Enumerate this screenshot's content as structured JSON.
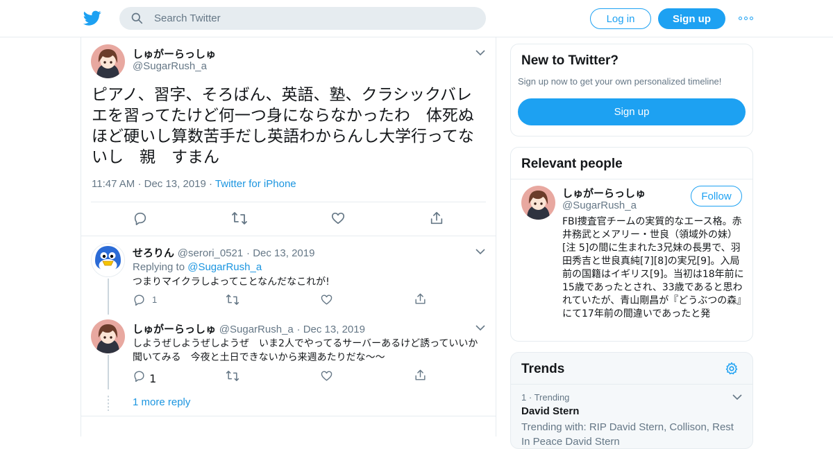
{
  "topbar": {
    "search_placeholder": "Search Twitter",
    "login_label": "Log in",
    "signup_label": "Sign up"
  },
  "main_tweet": {
    "name": "しゅがーらっしゅ",
    "handle": "@SugarRush_a",
    "text": "ピアノ、習字、そろばん、英語、塾、クラシックバレエを習ってたけど何一つ身にならなかったわ　体死ぬほど硬いし算数苦手だし英語わからんし大学行ってないし　親　すまん",
    "time": "11:47 AM",
    "date": "Dec 13, 2019",
    "source": "Twitter for iPhone"
  },
  "replies": [
    {
      "name": "せろりん",
      "handle": "@serori_0521",
      "date": "Dec 13, 2019",
      "replying_prefix": "Replying to",
      "replying_to": "@SugarRush_a",
      "text": "つまりマイクラしよってことなんだなこれが!",
      "reply_count": "1"
    },
    {
      "name": "しゅがーらっしゅ",
      "handle": "@SugarRush_a",
      "date": "Dec 13, 2019",
      "text": "しようぜしようぜしようぜ　いま2人でやってるサーバーあるけど誘っていいか聞いてみる　今夜と土日できないから来週あたりだな〜〜",
      "reply_count": "1"
    }
  ],
  "more_replies_label": "1 more reply",
  "new_to_twitter": {
    "title": "New to Twitter?",
    "subtitle": "Sign up now to get your own personalized timeline!",
    "button": "Sign up"
  },
  "relevant_people": {
    "title": "Relevant people",
    "name": "しゅがーらっしゅ",
    "handle": "@SugarRush_a",
    "follow_label": "Follow",
    "bio": "FBI捜査官チームの実質的なエース格。赤井務武とメアリー・世良（領域外の妹）[注 5]の間に生まれた3兄妹の長男で、羽田秀吉と世良真純[7][8]の実兄[9]。入局前の国籍はイギリス[9]。当初は18年前に15歳であったとされ、33歳であると思われていたが、青山剛昌が『どうぶつの森』にて17年前の間違いであったと発"
  },
  "trends": {
    "title": "Trends",
    "items": [
      {
        "rank": "1",
        "label": "Trending",
        "name": "David Stern",
        "with": "Trending with: RIP David Stern, Collison, Rest In Peace David Stern"
      }
    ]
  },
  "colors": {
    "accent": "#1da1f2",
    "link": "#1b95e0",
    "secondary_text": "#657786",
    "border": "#e6ecf0"
  }
}
